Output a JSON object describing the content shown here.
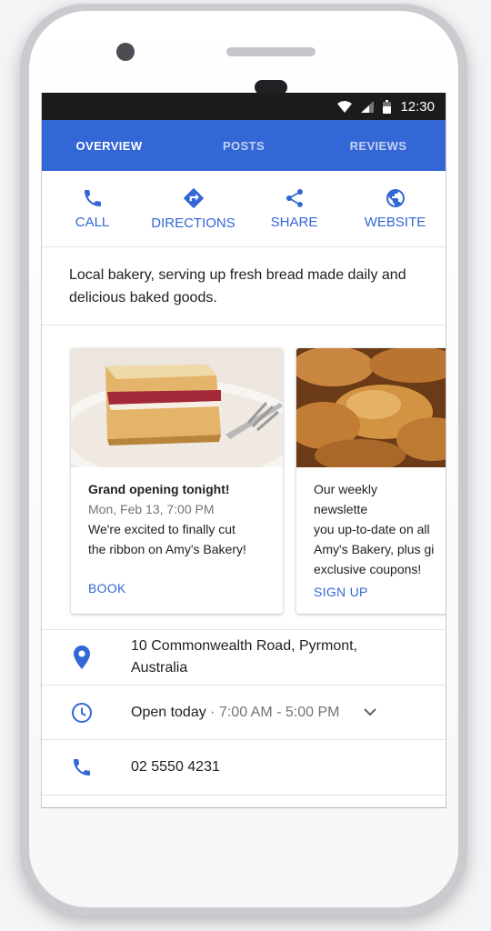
{
  "status": {
    "time": "12:30"
  },
  "tabs": [
    {
      "label": "OVERVIEW"
    },
    {
      "label": "POSTS"
    },
    {
      "label": "REVIEWS"
    }
  ],
  "actions": [
    {
      "label": "CALL",
      "icon": "phone-icon"
    },
    {
      "label": "DIRECTIONS",
      "icon": "directions-icon"
    },
    {
      "label": "SHARE",
      "icon": "share-icon"
    },
    {
      "label": "WEBSITE",
      "icon": "globe-icon"
    }
  ],
  "description": "Local bakery, serving up fresh bread made daily and delicious baked goods.",
  "posts": [
    {
      "title": "Grand opening tonight!",
      "date": "Mon, Feb 13, 7:00 PM",
      "text_line1": "We're excited to finally cut",
      "text_line2": "the ribbon on Amy's Bakery!",
      "cta": "BOOK"
    },
    {
      "line1": "Our weekly newslette",
      "line2": "you up-to-date on all",
      "line3": "Amy's Bakery, plus gi",
      "line4": "exclusive coupons!",
      "cta": "SIGN UP"
    }
  ],
  "info": {
    "address_line1": "10 Commonwealth Road, Pyrmont,",
    "address_line2": "Australia",
    "hours_status": "Open today",
    "hours_range": " · 7:00 AM - 5:00 PM",
    "phone": "02 5550 4231"
  },
  "colors": {
    "accent": "#3367d6",
    "text": "#202124",
    "muted": "#70757a"
  }
}
